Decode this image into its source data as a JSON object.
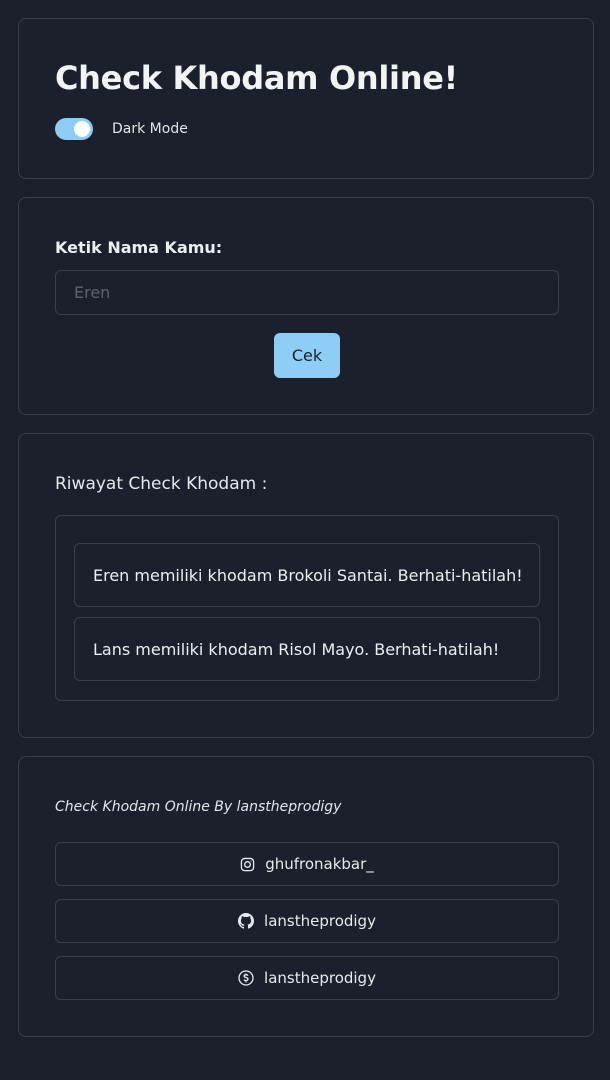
{
  "header": {
    "title": "Check Khodam Online!",
    "dark_mode_label": "Dark Mode",
    "dark_mode_on": true
  },
  "form": {
    "label": "Ketik Nama Kamu:",
    "input_value": "",
    "input_placeholder": "Eren",
    "button_label": "Cek"
  },
  "history": {
    "title": "Riwayat Check Khodam :",
    "items": [
      "Eren memiliki khodam Brokoli Santai. Berhati-hatilah!",
      "Lans memiliki khodam Risol Mayo. Berhati-hatilah!"
    ]
  },
  "footer": {
    "credit": "Check Khodam Online By lanstheprodigy",
    "links": [
      {
        "icon": "instagram-icon",
        "label": "ghufronakbar_"
      },
      {
        "icon": "github-icon",
        "label": "lanstheprodigy"
      },
      {
        "icon": "dollar-circle-icon",
        "label": "lanstheprodigy"
      }
    ]
  },
  "colors": {
    "background": "#1b202c",
    "border": "#3a3f4b",
    "accent": "#8ecdf6",
    "text": "#e8e9ec"
  }
}
